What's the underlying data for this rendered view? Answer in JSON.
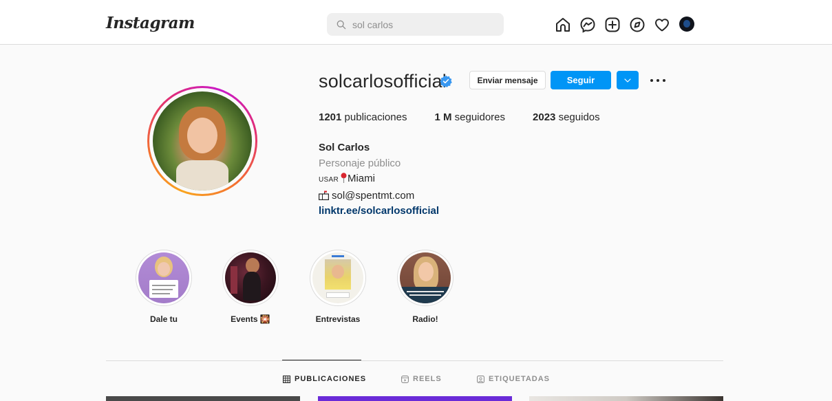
{
  "nav": {
    "logo": "Instagram",
    "search_value": "sol carlos",
    "icons": [
      "home-icon",
      "messenger-icon",
      "new-post-icon",
      "explore-icon",
      "activity-heart-icon",
      "profile-avatar"
    ]
  },
  "profile": {
    "username": "solcarlosofficial",
    "verified": true,
    "message_button": "Enviar mensaje",
    "follow_button": "Seguir",
    "stats": [
      {
        "count": "1201",
        "label": "publicaciones"
      },
      {
        "count": "1 M",
        "label": "seguidores"
      },
      {
        "count": "2023",
        "label": "seguidos"
      }
    ],
    "bio": {
      "name": "Sol Carlos",
      "category": "Personaje público",
      "location_prefix": "USAR",
      "location": "Miami",
      "email": "sol@spentmt.com",
      "link": "linktr.ee/solcarlosofficial"
    }
  },
  "highlights": [
    {
      "label": "Dale tu"
    },
    {
      "label": "Events 🎇"
    },
    {
      "label": "Entrevistas"
    },
    {
      "label": "Radio!"
    }
  ],
  "tabs": [
    {
      "label": "PUBLICACIONES",
      "active": true
    },
    {
      "label": "REELS",
      "active": false
    },
    {
      "label": "ETIQUETADAS",
      "active": false
    }
  ],
  "colors": {
    "accent": "#0095f6",
    "link": "#00376b",
    "muted": "#8e8e8e",
    "border": "#dbdbdb"
  }
}
